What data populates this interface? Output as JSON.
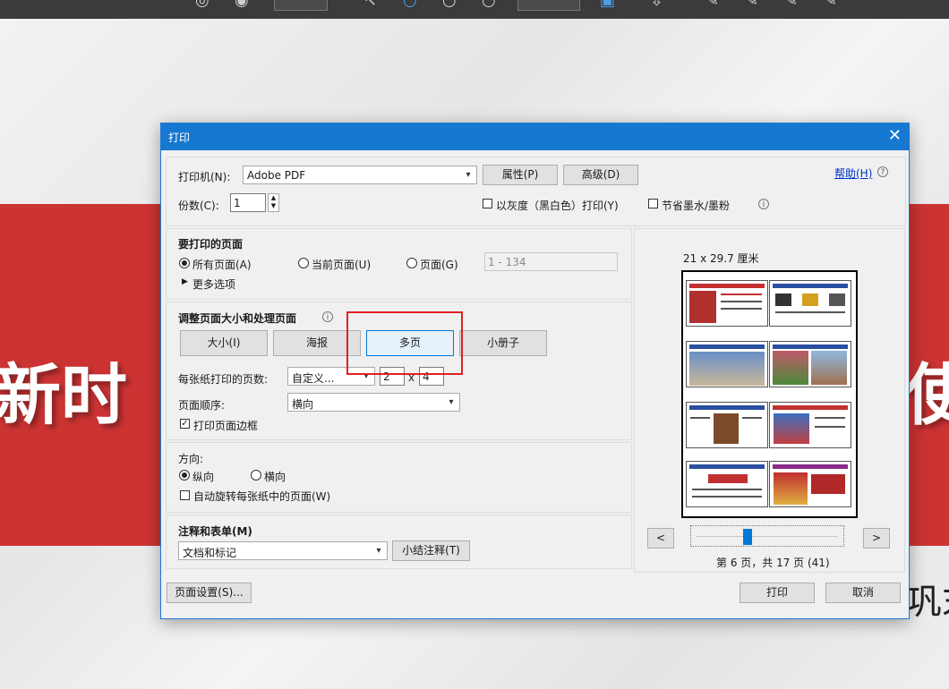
{
  "dialog": {
    "title": "打印",
    "printer_label": "打印机(N):",
    "printer_value": "Adobe PDF",
    "properties_button": "属性(P)",
    "advanced_button": "高级(D)",
    "help_link": "帮助(H)",
    "copies_label": "份数(C):",
    "copies_value": "1",
    "grayscale_label": "以灰度（黑白色）打印(Y)",
    "save_ink_label": "节省墨水/墨粉",
    "pages_section": {
      "title": "要打印的页面",
      "all_pages": "所有页面(A)",
      "current_page": "当前页面(U)",
      "pages": "页面(G)",
      "pages_range_placeholder": "1 - 134",
      "more_options": "更多选项"
    },
    "sizing_section": {
      "title": "调整页面大小和处理页面",
      "tabs": [
        "大小(I)",
        "海报",
        "多页",
        "小册子"
      ],
      "selected_tab": "多页",
      "pages_per_sheet_label": "每张纸打印的页数:",
      "pages_per_sheet_value": "自定义...",
      "cols_value": "2",
      "times_symbol": "x",
      "rows_value": "4",
      "page_order_label": "页面顺序:",
      "page_order_value": "横向",
      "print_border_label": "打印页面边框",
      "print_border_checked": true
    },
    "orientation_section": {
      "title": "方向:",
      "portrait": "纵向",
      "landscape": "横向",
      "auto_rotate": "自动旋转每张纸中的页面(W)",
      "selected": "纵向"
    },
    "annotations_section": {
      "title": "注释和表单(M)",
      "value": "文档和标记",
      "summarize_button": "小结注释(T)"
    },
    "preview": {
      "paper_size": "21 x 29.7 厘米",
      "prev_button": "<",
      "next_button": ">",
      "page_status": "第 6 页，共 17 页 (41)",
      "slider_fraction": 0.35
    },
    "page_setup_button": "页面设置(S)...",
    "print_button": "打印",
    "cancel_button": "取消"
  },
  "background": {
    "banner_text_left": "新时",
    "banner_text_right": "使",
    "bottom_text": "巩末"
  },
  "colors": {
    "titlebar": "#1778d2",
    "banner": "#cc3333",
    "highlight": "#e02020",
    "accent": "#0078d7"
  }
}
